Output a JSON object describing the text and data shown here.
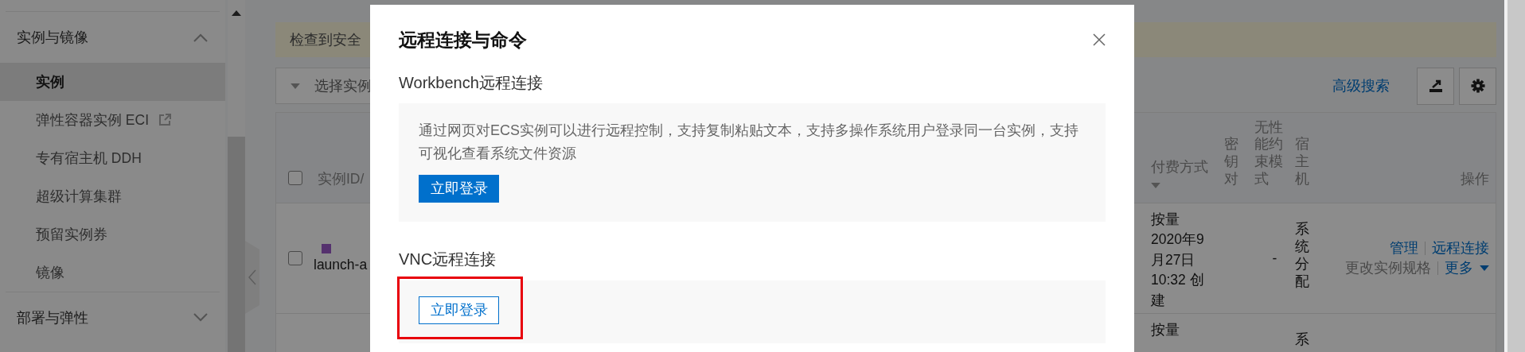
{
  "sidebar": {
    "groups": [
      {
        "label": "实例与镜像",
        "expanded": true,
        "items": [
          {
            "label": "实例",
            "selected": true
          },
          {
            "label": "弹性容器实例 ECI",
            "external": true,
            "selected": false
          },
          {
            "label": "专有宿主机 DDH",
            "selected": false
          },
          {
            "label": "超级计算集群",
            "selected": false
          },
          {
            "label": "预留实例券",
            "selected": false
          },
          {
            "label": "镜像",
            "selected": false
          }
        ]
      },
      {
        "label": "部署与弹性",
        "expanded": false
      }
    ]
  },
  "notice": {
    "text": "检查到安全"
  },
  "toolbar": {
    "instance_filter": "选择实例",
    "advanced_search": "高级搜索"
  },
  "table": {
    "all_selected": false,
    "columns": [
      {
        "label": "实例ID/"
      },
      {
        "label": "付费方式",
        "sortable": true
      },
      {
        "label": "密钥对",
        "kind": "narrow"
      },
      {
        "label": "无性能约束模式",
        "kind": "wide"
      },
      {
        "label": "宿主机",
        "kind": "narrow"
      },
      {
        "label": "操作"
      }
    ],
    "rows": [
      {
        "checked": false,
        "name": "launch-a",
        "billing": "按量",
        "created": "2020年9月27日 10:32 创建",
        "performance_mode": "-",
        "host": "系统分配",
        "actions": [
          "管理",
          "远程连接"
        ],
        "more_actions": [
          "更改实例规格",
          "更多"
        ]
      },
      {
        "billing": "按量",
        "host": "系"
      }
    ]
  },
  "dialog": {
    "title": "远程连接与命令",
    "sections": [
      {
        "title": "Workbench远程连接",
        "description": "通过网页对ECS实例可以进行远程控制，支持复制粘贴文本，支持多操作系统用户登录同一台实例，支持可视化查看系统文件资源",
        "button": {
          "label": "立即登录",
          "kind": "primary"
        },
        "highlighted": false
      },
      {
        "title": "VNC远程连接",
        "button": {
          "label": "立即登录",
          "kind": "secondary"
        },
        "highlighted": true
      }
    ]
  }
}
